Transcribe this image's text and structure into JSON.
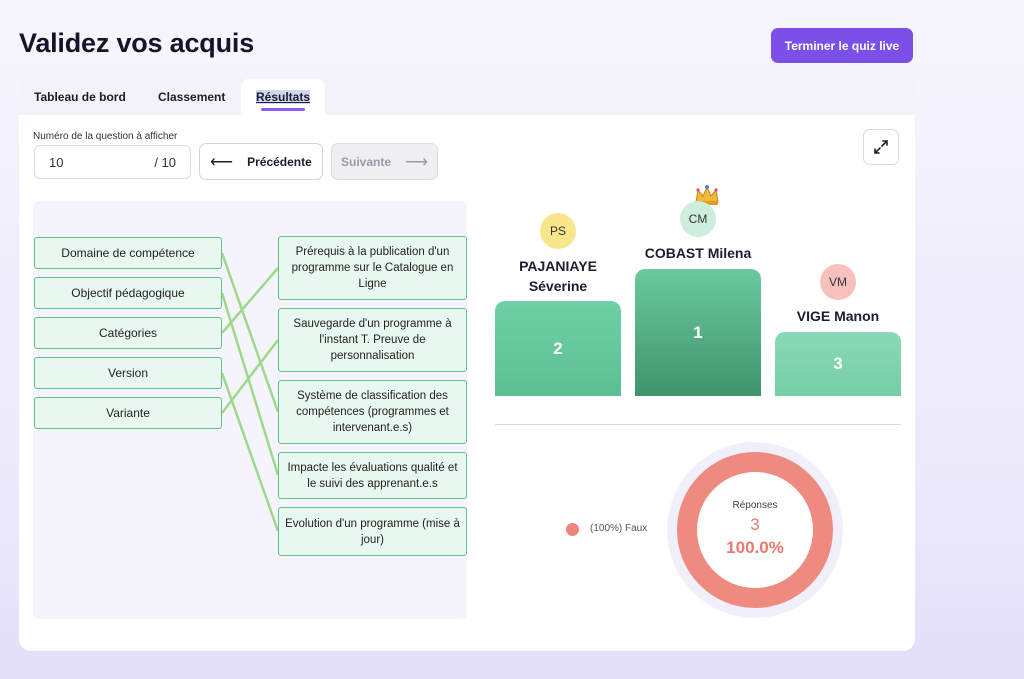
{
  "page": {
    "title": "Validez vos acquis",
    "end_button": "Terminer le quiz live"
  },
  "tabs": [
    {
      "label": "Tableau de bord"
    },
    {
      "label": "Classement"
    },
    {
      "label": "Résultats"
    }
  ],
  "question": {
    "label": "Numéro de la question à afficher",
    "value": "10",
    "total": "/ 10",
    "prev_label": "Précédente",
    "next_label": "Suivante"
  },
  "matching": {
    "left": [
      "Domaine de compétence",
      "Objectif pédagogique",
      "Catégories",
      "Version",
      "Variante"
    ],
    "right": [
      "Prérequis à la publication d'un programme sur le Catalogue en Ligne",
      "Sauvegarde d'un programme à l'instant T. Preuve de personnalisation",
      "Système de classification des compétences (programmes et intervenant.e.s)",
      "Impacte les évaluations qualité et le suivi des apprenant.e.s",
      "Evolution d'un programme (mise à jour)"
    ],
    "links": [
      [
        0,
        2
      ],
      [
        1,
        3
      ],
      [
        2,
        0
      ],
      [
        3,
        4
      ],
      [
        4,
        1
      ]
    ]
  },
  "leaderboard": {
    "entries": [
      {
        "rank": "2",
        "initials": "PS",
        "name": "PAJANIAYE Séverine",
        "avatar_color": "#f8e68c"
      },
      {
        "rank": "1",
        "initials": "CM",
        "name": "COBAST Milena",
        "avatar_color": "#cdeedd"
      },
      {
        "rank": "3",
        "initials": "VM",
        "name": "VIGE Manon",
        "avatar_color": "#f6c0bc"
      }
    ]
  },
  "responses": {
    "title": "Réponses",
    "count": "3",
    "percent": "100.0%",
    "legend": "(100%) Faux",
    "color": "#ee8576"
  },
  "colors": {
    "accent": "#7b4fe8",
    "match_border": "#5fc08a",
    "podium": "#6fcfa4"
  }
}
